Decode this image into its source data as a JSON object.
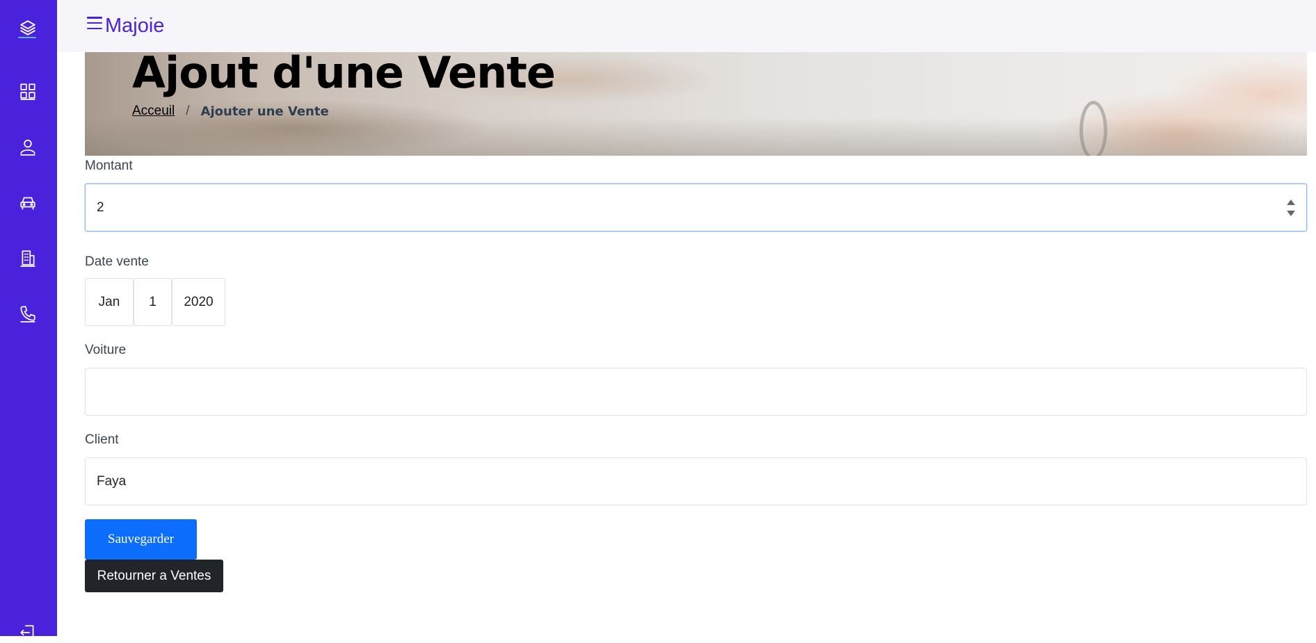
{
  "app": {
    "brand": "Majoie"
  },
  "sidebar": {
    "items": [
      {
        "icon": "layers-icon"
      },
      {
        "icon": "dashboard-grid-icon"
      },
      {
        "icon": "user-icon"
      },
      {
        "icon": "car-icon"
      },
      {
        "icon": "building-icon"
      },
      {
        "icon": "phone-icon"
      },
      {
        "icon": "logout-icon"
      }
    ],
    "background": "#4a22dc"
  },
  "header": {
    "title": "Ajout d'une Vente",
    "breadcrumb": {
      "home": "Acceuil",
      "separator": "/",
      "current": "Ajouter une Vente"
    }
  },
  "form": {
    "montant": {
      "label": "Montant",
      "value": "2"
    },
    "date": {
      "label": "Date vente",
      "month": "Jan",
      "day": "1",
      "year": "2020"
    },
    "voiture": {
      "label": "Voiture",
      "value": ""
    },
    "client": {
      "label": "Client",
      "value": "Faya"
    },
    "save_label": "Sauvegarder",
    "back_label": "Retourner a Ventes"
  },
  "colors": {
    "accent": "#4a22dc",
    "primary_button": "#0d6efd",
    "dark_button": "#212529",
    "focus_border": "#86b7fe"
  }
}
